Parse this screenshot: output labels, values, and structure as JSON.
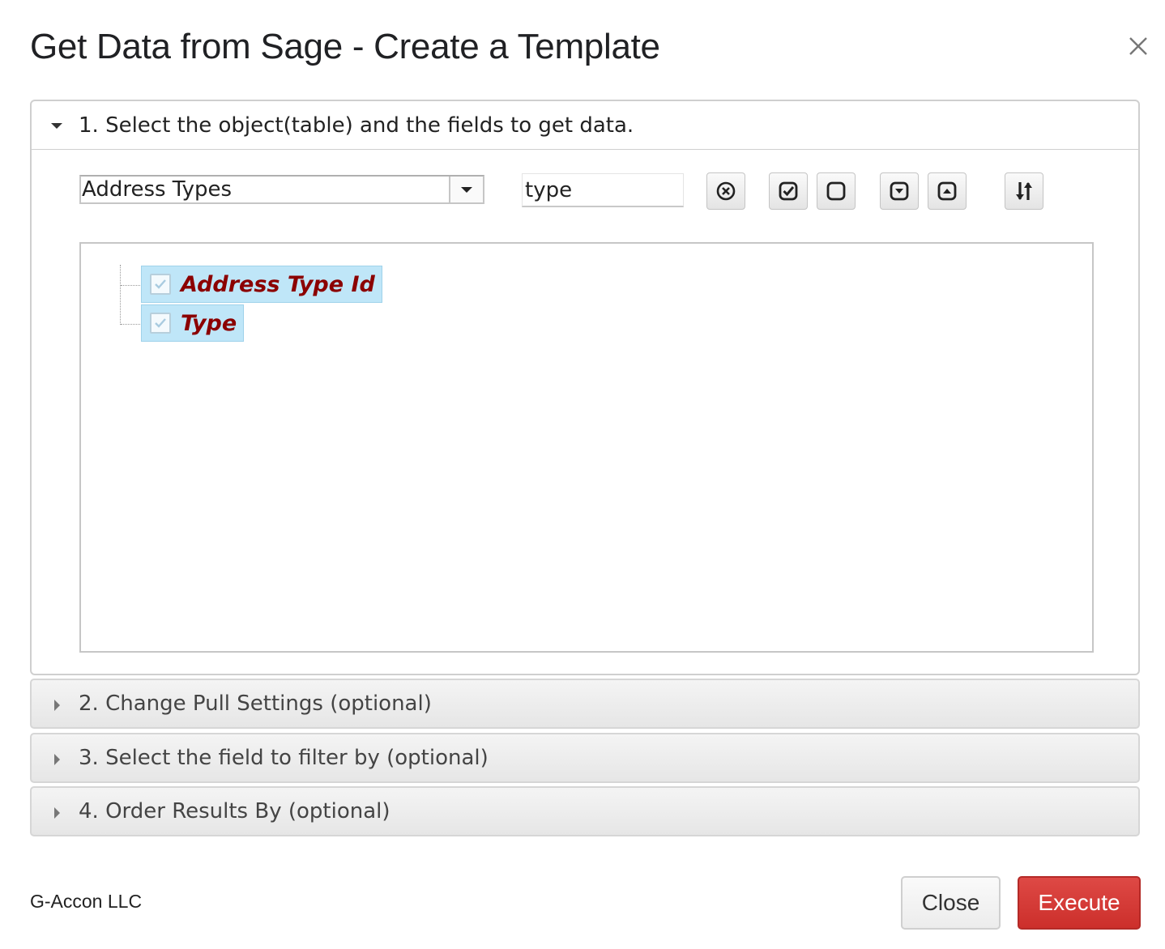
{
  "dialog": {
    "title": "Get Data from Sage - Create a Template",
    "close_icon": "close-icon"
  },
  "sections": [
    {
      "label": "1. Select the object(table) and the fields to get data.",
      "expanded": true
    },
    {
      "label": "2. Change Pull Settings (optional)",
      "expanded": false
    },
    {
      "label": "3. Select the field to filter by (optional)",
      "expanded": false
    },
    {
      "label": "4. Order Results By (optional)",
      "expanded": false
    }
  ],
  "object_select": {
    "value": "Address Types"
  },
  "field_filter": {
    "value": "type"
  },
  "toolbar": {
    "buttons": [
      {
        "name": "clear-filter-button",
        "icon": "x-circle-icon"
      },
      {
        "name": "check-all-button",
        "icon": "check-square-icon"
      },
      {
        "name": "uncheck-all-button",
        "icon": "square-icon"
      },
      {
        "name": "expand-all-button",
        "icon": "caret-down-square-icon"
      },
      {
        "name": "collapse-all-button",
        "icon": "caret-up-square-icon"
      },
      {
        "name": "sort-button",
        "icon": "sort-icon"
      }
    ]
  },
  "field_tree": {
    "items": [
      {
        "label": "Address Type Id",
        "checked": true
      },
      {
        "label": "Type",
        "checked": true
      }
    ]
  },
  "footer": {
    "company": "G-Accon LLC",
    "close_label": "Close",
    "execute_label": "Execute"
  },
  "colors": {
    "execute": "#d43f3a",
    "selected_node_bg": "#bfe6f8",
    "field_text": "#8b0000"
  }
}
